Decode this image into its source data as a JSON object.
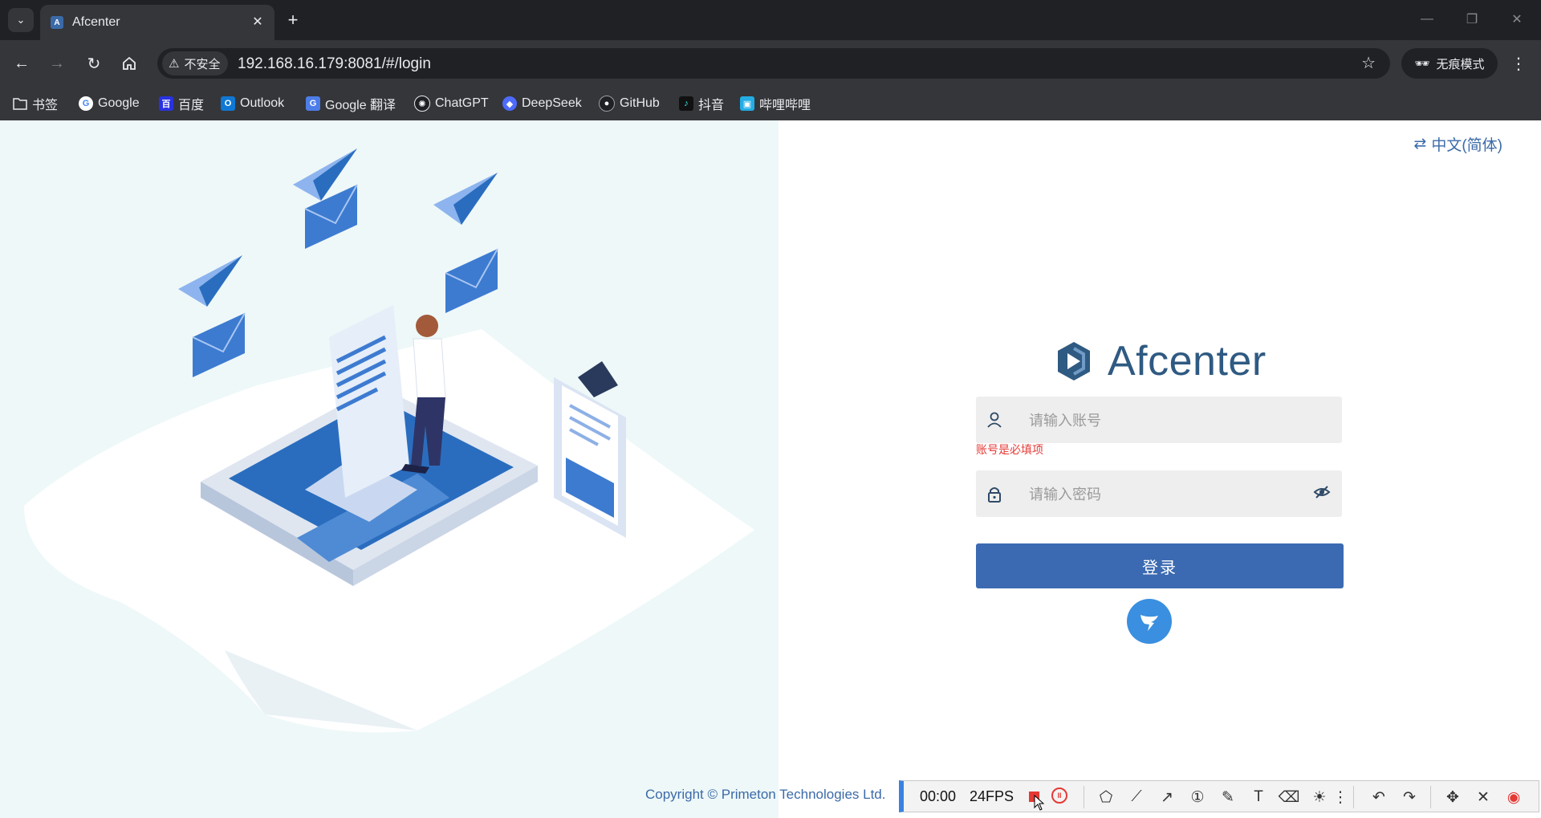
{
  "browser": {
    "tab": {
      "title": "Afcenter",
      "favicon": "A"
    },
    "address": {
      "security_label": "不安全",
      "url": "192.168.16.179:8081/#/login"
    },
    "incognito_label": "无痕模式",
    "bookmarks": [
      {
        "label": "书签",
        "icon": "folder-icon",
        "color": "#e8eaed"
      },
      {
        "label": "Google",
        "icon": "google-icon",
        "color": "#4285f4"
      },
      {
        "label": "百度",
        "icon": "baidu-icon",
        "color": "#2932e1"
      },
      {
        "label": "Outlook",
        "icon": "outlook-icon",
        "color": "#0f78d4"
      },
      {
        "label": "Google 翻译",
        "icon": "google-translate-icon",
        "color": "#4d7de8"
      },
      {
        "label": "ChatGPT",
        "icon": "chatgpt-icon",
        "color": "#202124"
      },
      {
        "label": "DeepSeek",
        "icon": "deepseek-icon",
        "color": "#4d6bfe"
      },
      {
        "label": "GitHub",
        "icon": "github-icon",
        "color": "#202124"
      },
      {
        "label": "抖音",
        "icon": "douyin-icon",
        "color": "#111111"
      },
      {
        "label": "哔哩哔哩",
        "icon": "bilibili-icon",
        "color": "#23ade5"
      }
    ]
  },
  "page": {
    "language_label": "中文(简体)",
    "brand_name": "Afcenter",
    "account_placeholder": "请输入账号",
    "account_error": "账号是必填项",
    "password_placeholder": "请输入密码",
    "login_label": "登录",
    "copyright": "Copyright © Primeton Technologies Ltd."
  },
  "recorder": {
    "time": "00:00",
    "fps": "24FPS"
  },
  "colors": {
    "accent": "#3b6ab2",
    "brand": "#2f5a82",
    "error": "#e53935",
    "illustration_bg": "#eef8f8"
  }
}
